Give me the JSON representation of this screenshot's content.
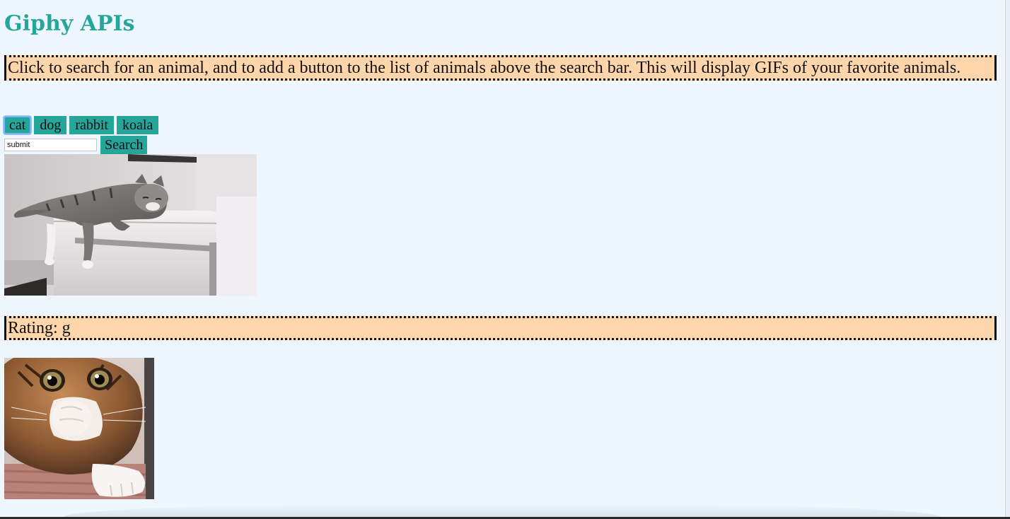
{
  "header": {
    "title": "Giphy APIs"
  },
  "instructions": {
    "text": "Click to search for an animal, and to add a button to the list of animals above the search bar. This will display GIFs of your favorite animals."
  },
  "animal_buttons": [
    {
      "label": "cat",
      "focused": true
    },
    {
      "label": "dog",
      "focused": false
    },
    {
      "label": "rabbit",
      "focused": false
    },
    {
      "label": "koala",
      "focused": false
    }
  ],
  "search": {
    "input_value": "submit",
    "button_label": "Search"
  },
  "results": [
    {
      "rating_text": "Rating: g"
    }
  ],
  "colors": {
    "accent": "#26a69a",
    "panel": "#ffd5ab",
    "background": "#eef6ff"
  }
}
